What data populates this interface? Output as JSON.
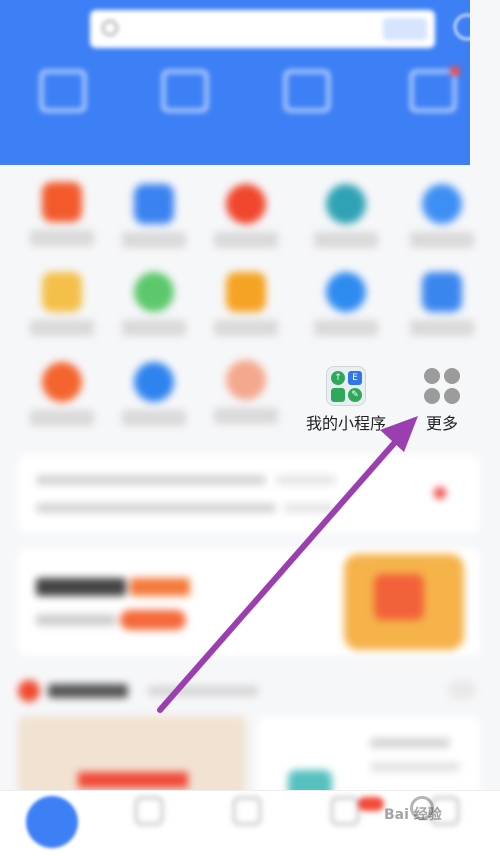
{
  "colors": {
    "accent": "#3d7ff5",
    "annotation_arrow": "#9b3fb0"
  },
  "grid_row3": {
    "mini_program": {
      "label": "我的小程序",
      "icon": "mini-program-icon"
    },
    "more": {
      "label": "更多",
      "icon": "more-grid-icon"
    }
  },
  "watermark": {
    "text": "Bai 经验"
  }
}
